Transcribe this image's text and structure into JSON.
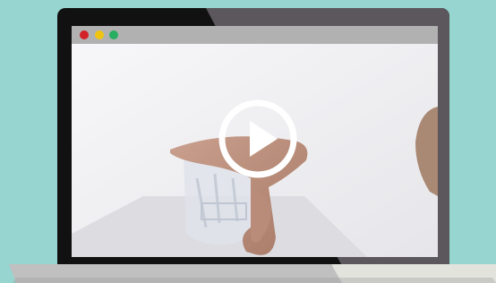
{
  "colors": {
    "background": "#96d5d0",
    "bezel": "#111111",
    "bezel_shine": "#5b575c",
    "browser_bar": "#b1b1b1",
    "close_dot": "#d32128",
    "minimize_dot": "#f1c40f",
    "maximize_dot": "#27ae60",
    "base_left": "#c0c0c0",
    "base_right": "#e2e3dd"
  },
  "icons": {
    "play": "play-icon",
    "window_controls": [
      "close-dot",
      "minimize-dot",
      "maximize-dot"
    ]
  },
  "video": {
    "state": "paused",
    "subject": "product"
  }
}
